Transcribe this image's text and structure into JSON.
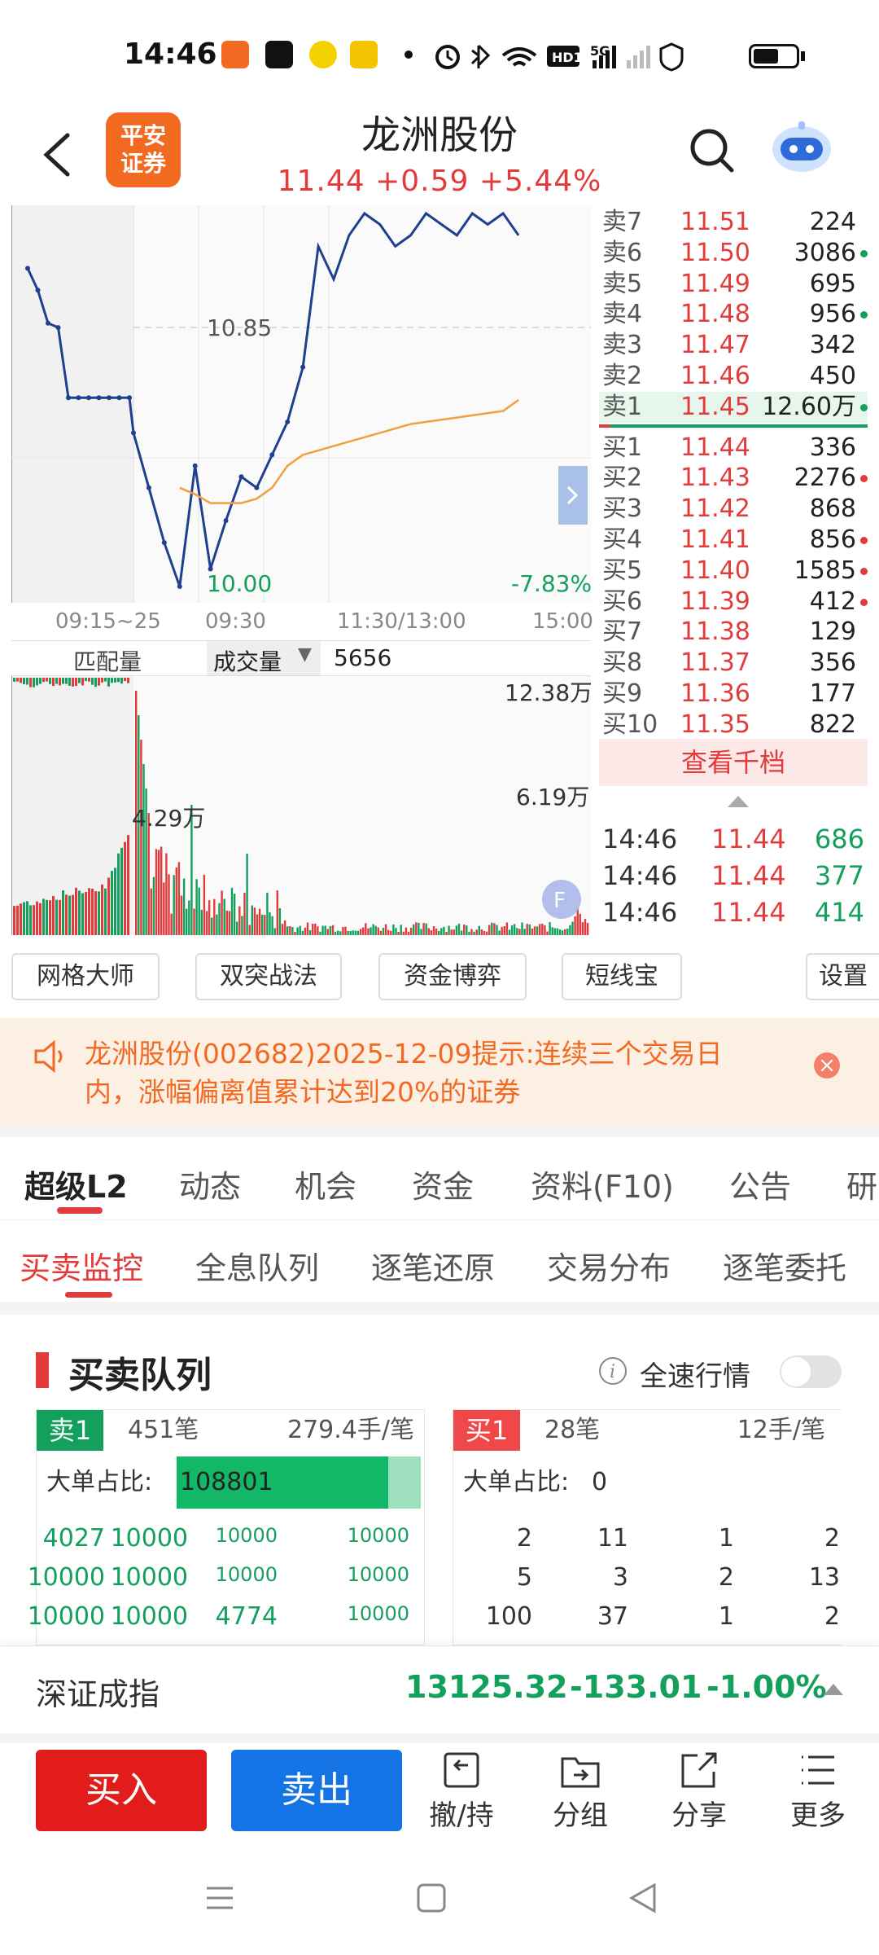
{
  "status_bar": {
    "time": "14:46",
    "network": "5G",
    "hd": "HD1"
  },
  "header": {
    "logo_line1": "平安",
    "logo_line2": "证券",
    "title": "龙洲股份",
    "subtitle": "11.44 +0.59 +5.44%"
  },
  "chart": {
    "ref_price": "10.85",
    "low_price": "10.00",
    "low_pct": "-7.83%",
    "time_labels": [
      "09:15~25",
      "09:30",
      "11:30/13:00",
      "15:00"
    ],
    "vol_tabs": {
      "match": "匹配量",
      "volume": "成交量",
      "value": "5656"
    },
    "vol_max": "12.38万",
    "vol_mid": "6.19万",
    "vol_auction": "4.29万"
  },
  "chart_data": {
    "type": "line",
    "title": "",
    "ylim": [
      10.0,
      11.7
    ],
    "ref_line": 10.85,
    "series": [
      {
        "name": "",
        "values": [
          11.45,
          11.35,
          11.2,
          11.18,
          10.86,
          10.86,
          10.86,
          10.86,
          10.86,
          10.86,
          10.86,
          10.7,
          10.45,
          10.2,
          10.0,
          10.55,
          10.08,
          10.3,
          10.5,
          10.45,
          10.6,
          10.75,
          11.0,
          11.55,
          11.4,
          11.6,
          11.7,
          11.65,
          11.55,
          11.6,
          11.7,
          11.65,
          11.6,
          11.7,
          11.65,
          11.7,
          11.6
        ]
      },
      {
        "name": "",
        "values": [
          null,
          null,
          null,
          null,
          null,
          null,
          null,
          null,
          null,
          null,
          null,
          null,
          null,
          null,
          10.45,
          10.42,
          10.38,
          10.38,
          10.38,
          10.4,
          10.45,
          10.55,
          10.6,
          10.62,
          10.64,
          10.66,
          10.68,
          10.7,
          10.72,
          10.74,
          10.75,
          10.76,
          10.77,
          10.78,
          10.79,
          10.8,
          10.85
        ]
      }
    ]
  },
  "order_book": {
    "asks": [
      {
        "label": "卖7",
        "price": "11.51",
        "vol": "224",
        "dot": ""
      },
      {
        "label": "卖6",
        "price": "11.50",
        "vol": "3086",
        "dot": "#12a05c"
      },
      {
        "label": "卖5",
        "price": "11.49",
        "vol": "695",
        "dot": ""
      },
      {
        "label": "卖4",
        "price": "11.48",
        "vol": "956",
        "dot": "#12a05c"
      },
      {
        "label": "卖3",
        "price": "11.47",
        "vol": "342",
        "dot": ""
      },
      {
        "label": "卖2",
        "price": "11.46",
        "vol": "450",
        "dot": ""
      },
      {
        "label": "卖1",
        "price": "11.45",
        "vol": "12.60万",
        "dot": "#12a05c"
      }
    ],
    "bids": [
      {
        "label": "买1",
        "price": "11.44",
        "vol": "336",
        "dot": ""
      },
      {
        "label": "买2",
        "price": "11.43",
        "vol": "2276",
        "dot": "#e23b3b"
      },
      {
        "label": "买3",
        "price": "11.42",
        "vol": "868",
        "dot": ""
      },
      {
        "label": "买4",
        "price": "11.41",
        "vol": "856",
        "dot": "#e23b3b"
      },
      {
        "label": "买5",
        "price": "11.40",
        "vol": "1585",
        "dot": "#e23b3b"
      },
      {
        "label": "买6",
        "price": "11.39",
        "vol": "412",
        "dot": "#e23b3b"
      },
      {
        "label": "买7",
        "price": "11.38",
        "vol": "129",
        "dot": ""
      },
      {
        "label": "买8",
        "price": "11.37",
        "vol": "356",
        "dot": ""
      },
      {
        "label": "买9",
        "price": "11.36",
        "vol": "177",
        "dot": ""
      },
      {
        "label": "买10",
        "price": "11.35",
        "vol": "822",
        "dot": ""
      }
    ],
    "view_more": "查看千档",
    "trades": [
      {
        "time": "14:46",
        "price": "11.44",
        "vol": "686"
      },
      {
        "time": "14:46",
        "price": "11.44",
        "vol": "377"
      },
      {
        "time": "14:46",
        "price": "11.44",
        "vol": "414"
      }
    ]
  },
  "tools": [
    "网格大师",
    "双突战法",
    "资金博弈",
    "短线宝",
    "设置"
  ],
  "notice": {
    "text": "龙洲股份(002682)2025-12-09提示:连续三个交易日内，涨幅偏离值累计达到20%的证券",
    "close": "×"
  },
  "tabs_main": [
    "超级L2",
    "动态",
    "机会",
    "资金",
    "资料(F10)",
    "公告",
    "研"
  ],
  "tabs_sub": [
    "买卖监控",
    "全息队列",
    "逐笔还原",
    "交易分布",
    "逐笔委托"
  ],
  "queue": {
    "title": "买卖队列",
    "full_speed": "全速行情",
    "sell": {
      "badge": "卖1",
      "count": "451笔",
      "avg": "279.4手/笔",
      "big_label": "大单占比:",
      "big_value": "108801",
      "rows": [
        [
          "4027",
          "10000",
          "10000",
          "10000"
        ],
        [
          "10000",
          "10000",
          "10000",
          "10000"
        ],
        [
          "10000",
          "10000",
          "4774",
          "10000"
        ]
      ]
    },
    "buy": {
      "badge": "买1",
      "count": "28笔",
      "avg": "12手/笔",
      "big_label": "大单占比:",
      "big_value": "0",
      "rows": [
        [
          "2",
          "11",
          "1",
          "2"
        ],
        [
          "5",
          "3",
          "2",
          "13"
        ],
        [
          "100",
          "37",
          "1",
          "2"
        ]
      ]
    }
  },
  "index": {
    "name": "深证成指",
    "value": "13125.32",
    "change": "-133.01",
    "pct": "-1.00%"
  },
  "bottom": {
    "buy": "买入",
    "sell": "卖出",
    "cancel": "撤/持",
    "group": "分组",
    "share": "分享",
    "more": "更多"
  },
  "colors": {
    "up": "#e23b3b",
    "down": "#12a05c",
    "line": "#1f3f8f",
    "avg": "#f0a040",
    "brand": "#f26a21"
  }
}
